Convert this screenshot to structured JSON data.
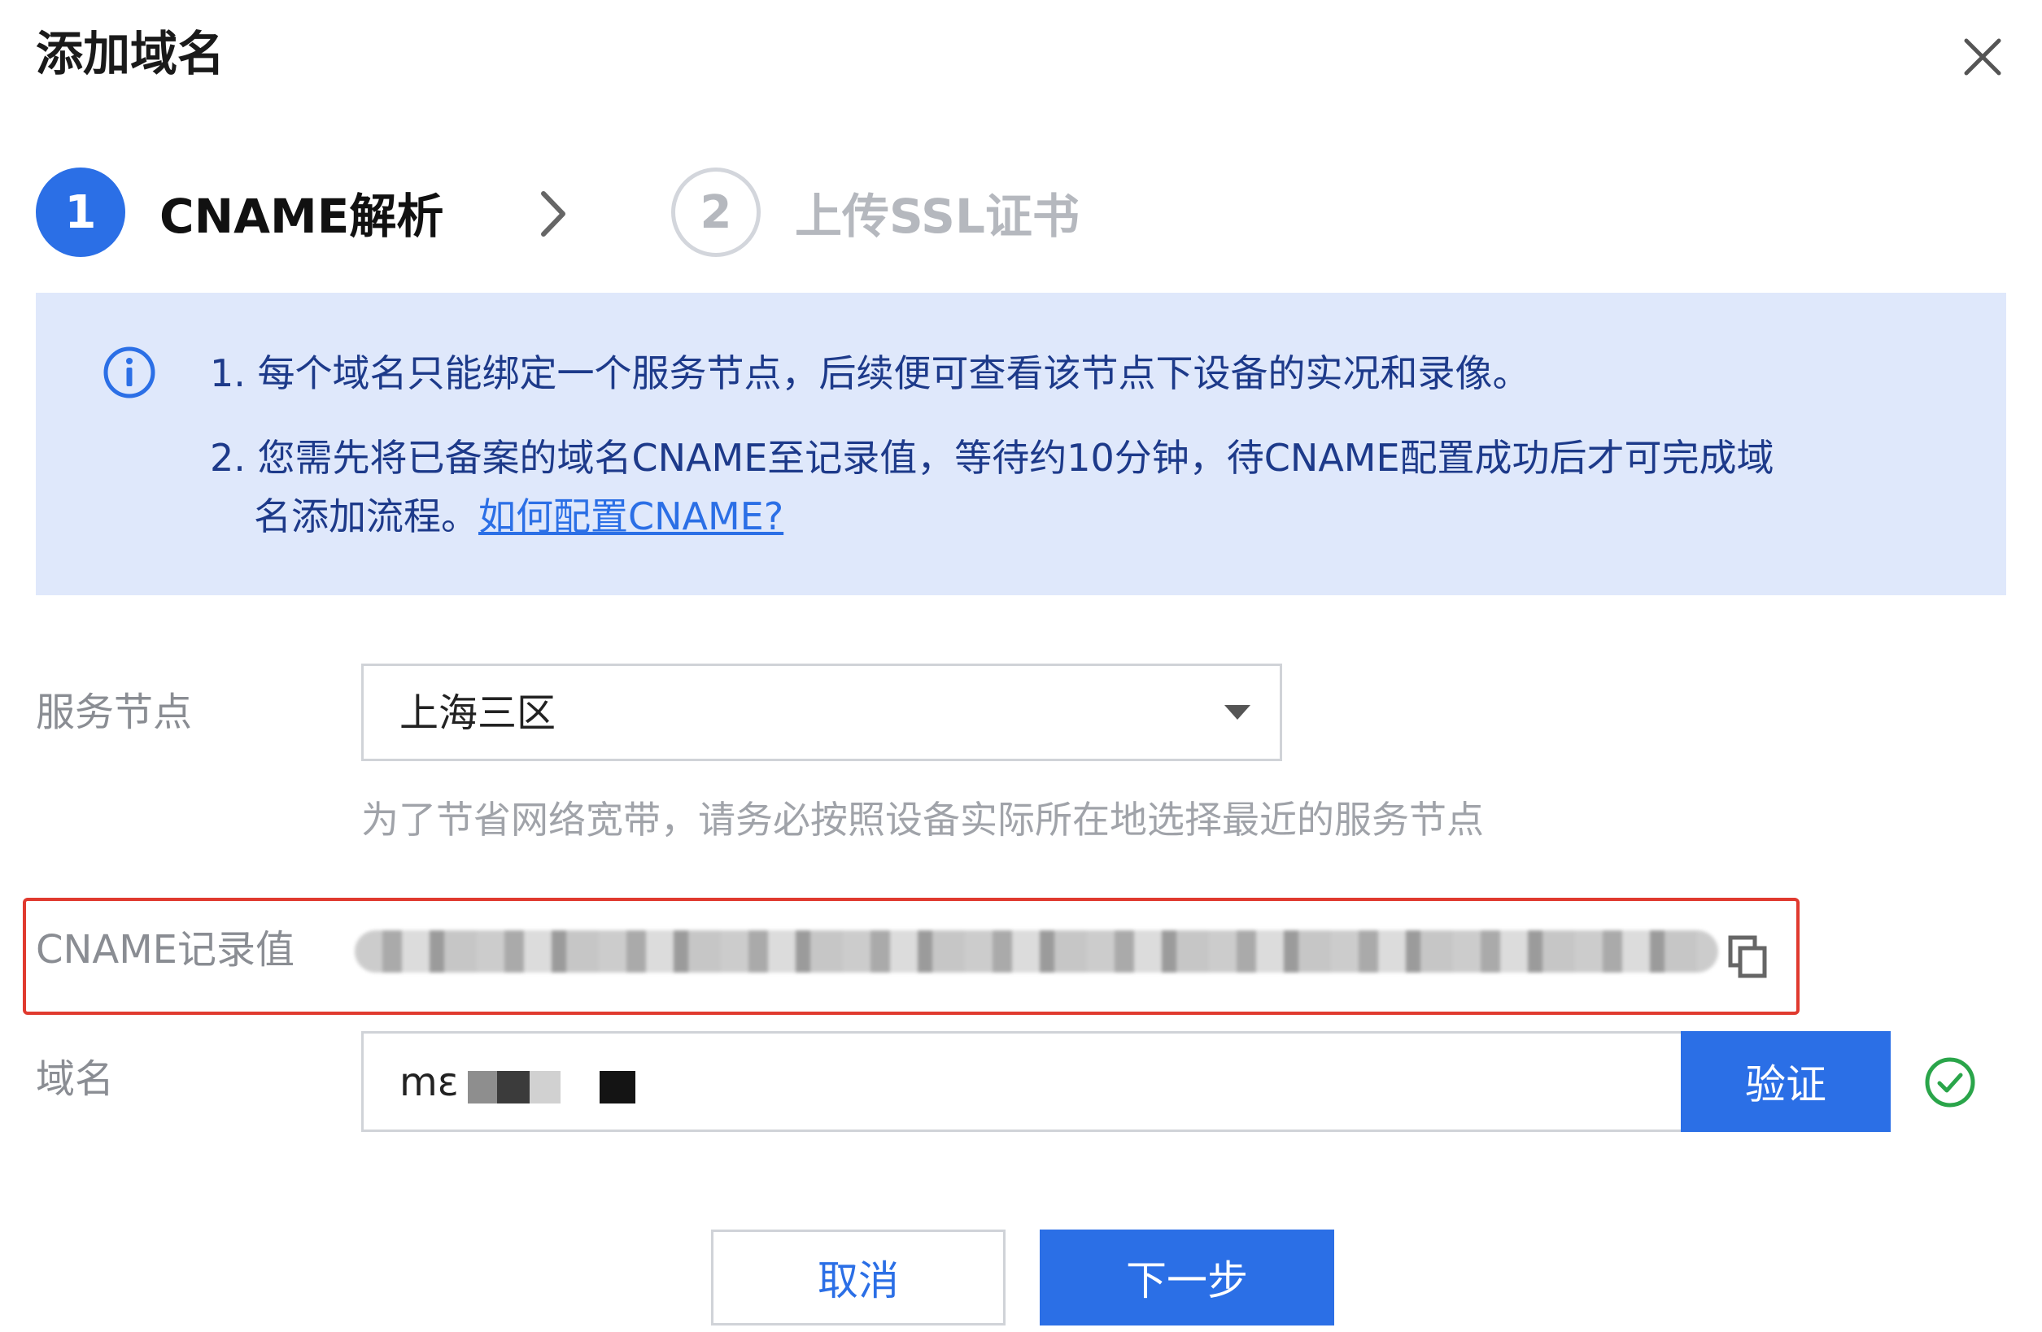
{
  "dialog": {
    "title": "添加域名",
    "close_icon": "close-icon"
  },
  "steps": [
    {
      "number": "1",
      "label": "CNAME解析",
      "state": "active"
    },
    {
      "number": "2",
      "label": "上传SSL证书",
      "state": "inactive"
    }
  ],
  "info": {
    "icon": "info-icon",
    "line1": "1. 每个域名只能绑定一个服务节点，后续便可查看该节点下设备的实况和录像。",
    "line2": "2. 您需先将已备案的域名CNAME至记录值，等待约10分钟，待CNAME配置成功后才可完成域",
    "line3": "名添加流程。",
    "link": "如何配置CNAME? "
  },
  "form": {
    "service_node": {
      "label": "服务节点",
      "value": "上海三区",
      "help": "为了节省网络宽带，请务必按照设备实际所在地选择最近的服务节点"
    },
    "cname": {
      "label": "CNAME记录值",
      "copy_icon": "copy-icon"
    },
    "domain": {
      "label": "域名",
      "value": "mε",
      "verify_label": "验证",
      "status_icon": "check-circle-icon"
    }
  },
  "footer": {
    "cancel_label": "取消",
    "next_label": "下一步"
  },
  "colors": {
    "primary": "#2b6fe6",
    "banner_bg": "#dfe8fb",
    "highlight": "#e03a2f",
    "success": "#2aa54a"
  }
}
